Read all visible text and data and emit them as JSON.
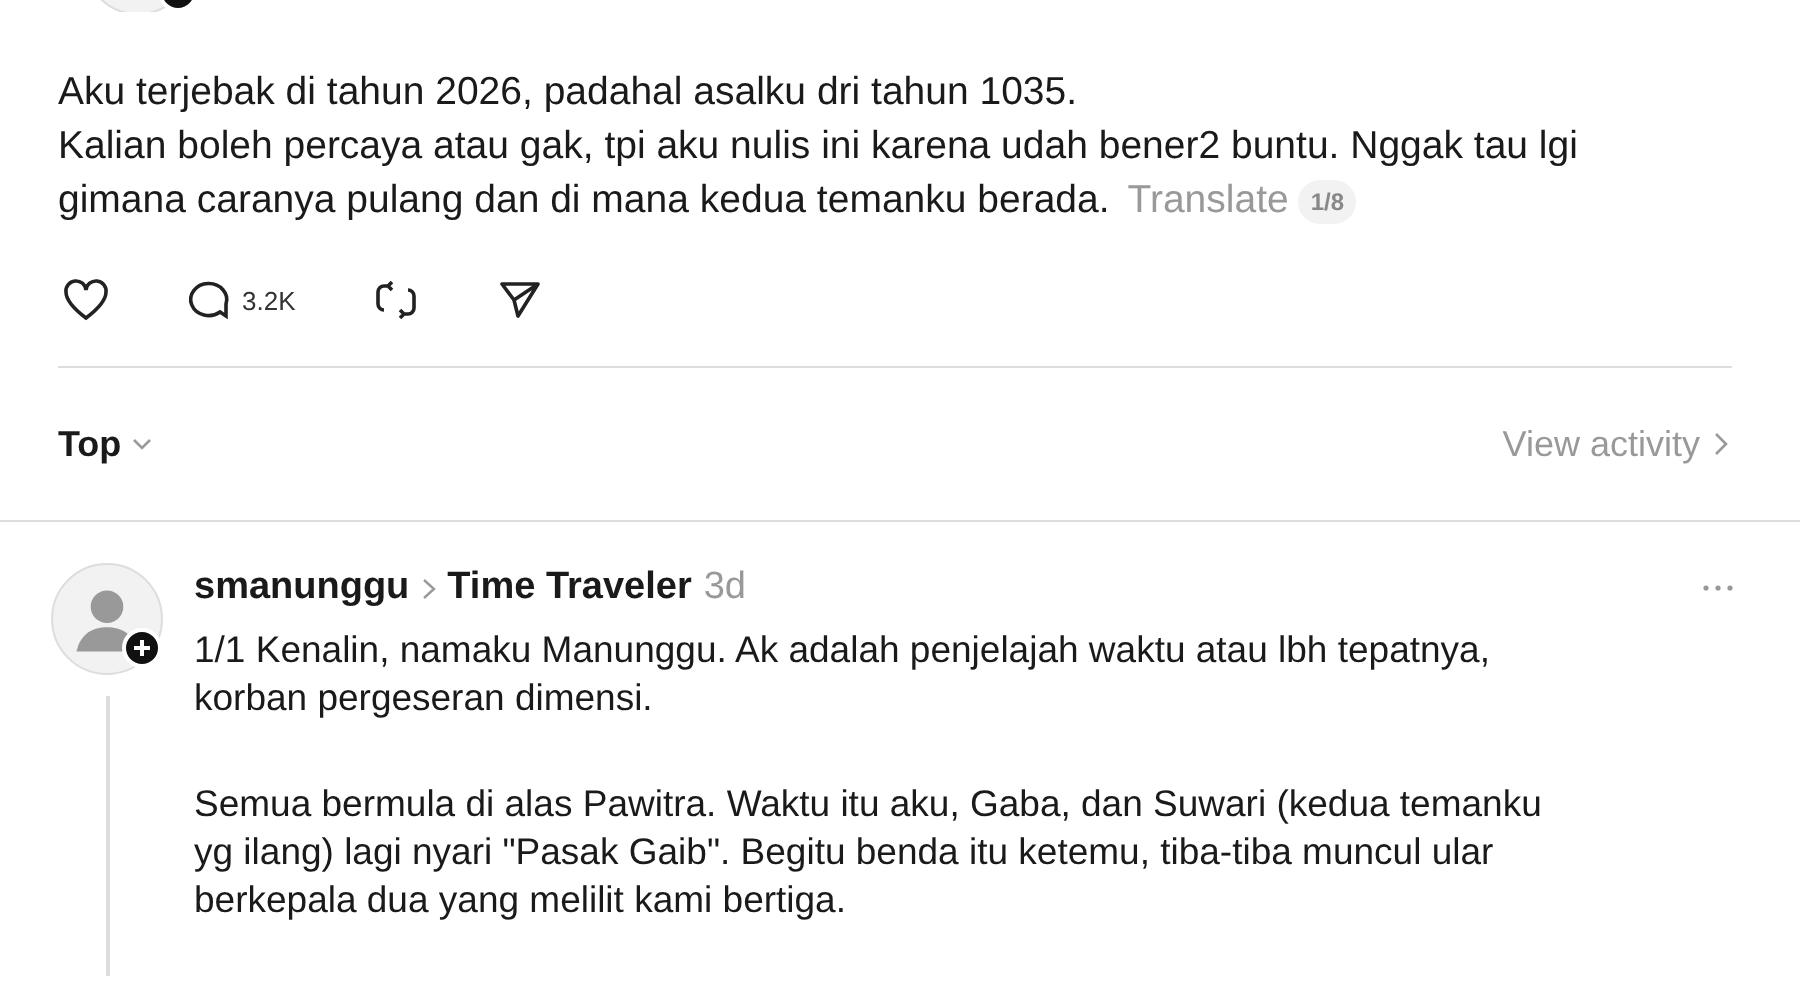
{
  "post": {
    "paragraphs": [
      "Aku terjebak di tahun 2026, padahal asalku dri tahun 1035.",
      "Kalian boleh percaya atau gak, tpi aku nulis ini karena udah bener2 buntu. Nggak tau lgi",
      "gimana caranya pulang dan di mana kedua temanku berada."
    ],
    "translate": "Translate",
    "page_badge": "1/8",
    "actions": [
      {
        "kind": "like"
      },
      {
        "kind": "reply",
        "count": "3.2K"
      },
      {
        "kind": "repost"
      },
      {
        "kind": "share"
      }
    ]
  },
  "sort": {
    "label": "Top",
    "link": "View activity"
  },
  "reply": {
    "username": "smanunggu",
    "topic": "Time Traveler",
    "time": "3d",
    "paragraphs": [
      [
        "1/1 Kenalin, namaku Manunggu. Ak adalah penjelajah waktu atau lbh tepatnya,",
        "korban pergeseran dimensi."
      ],
      [
        "Semua bermula di alas Pawitra. Waktu itu aku, Gaba, dan Suwari (kedua temanku",
        "yg ilang) lagi nyari \"Pasak Gaib\". Begitu benda itu ketemu, tiba-tiba muncul ular",
        "berkepala dua yang melilit kami bertiga."
      ]
    ]
  }
}
